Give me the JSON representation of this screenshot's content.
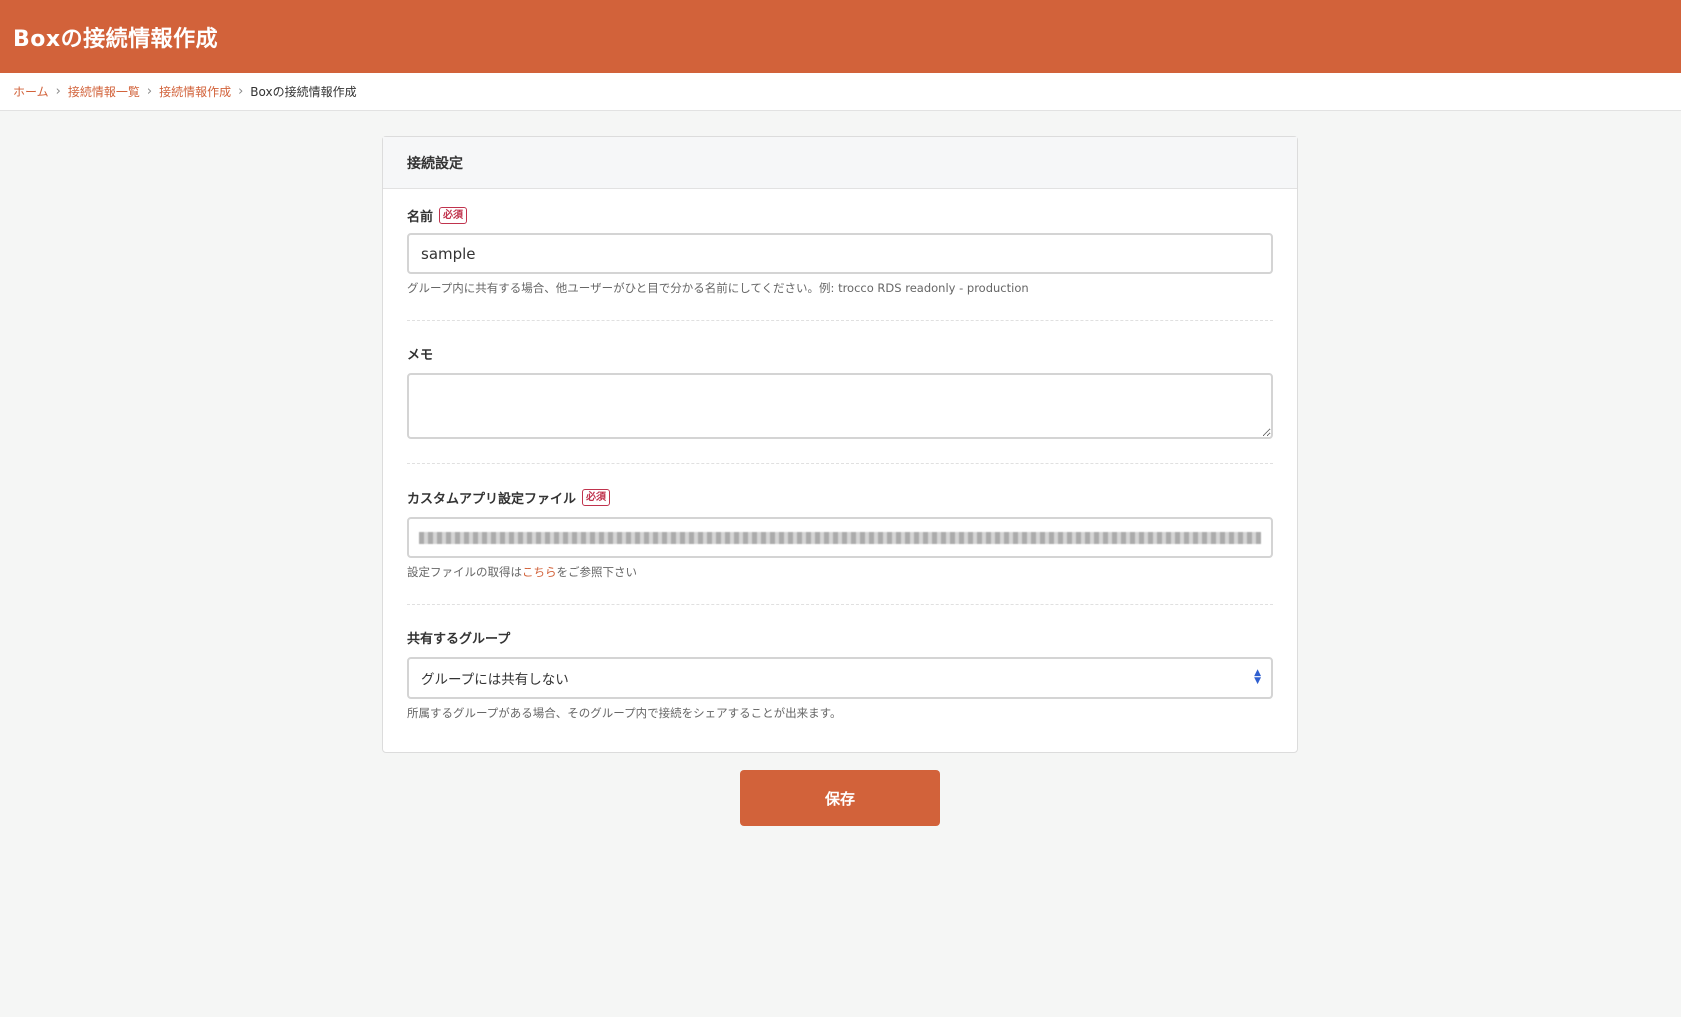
{
  "header": {
    "title": "Boxの接続情報作成"
  },
  "breadcrumb": {
    "items": [
      "ホーム",
      "接続情報一覧",
      "接続情報作成"
    ],
    "current": "Boxの接続情報作成"
  },
  "card": {
    "title": "接続設定"
  },
  "fields": {
    "name": {
      "label": "名前",
      "required_badge": "必須",
      "value": "sample",
      "help": "グループ内に共有する場合、他ユーザーがひと目で分かる名前にしてください。例: trocco RDS readonly - production"
    },
    "memo": {
      "label": "メモ",
      "value": ""
    },
    "config_file": {
      "label": "カスタムアプリ設定ファイル",
      "required_badge": "必須",
      "help_before": "設定ファイルの取得は",
      "help_link": "こちら",
      "help_after": "をご参照下さい"
    },
    "group": {
      "label": "共有するグループ",
      "selected": "グループには共有しない",
      "help": "所属するグループがある場合、そのグループ内で接続をシェアすることが出来ます。"
    }
  },
  "actions": {
    "save_label": "保存"
  },
  "colors": {
    "brand": "#d2623a",
    "required": "#c0334d",
    "select_arrow": "#2f5fd0"
  }
}
